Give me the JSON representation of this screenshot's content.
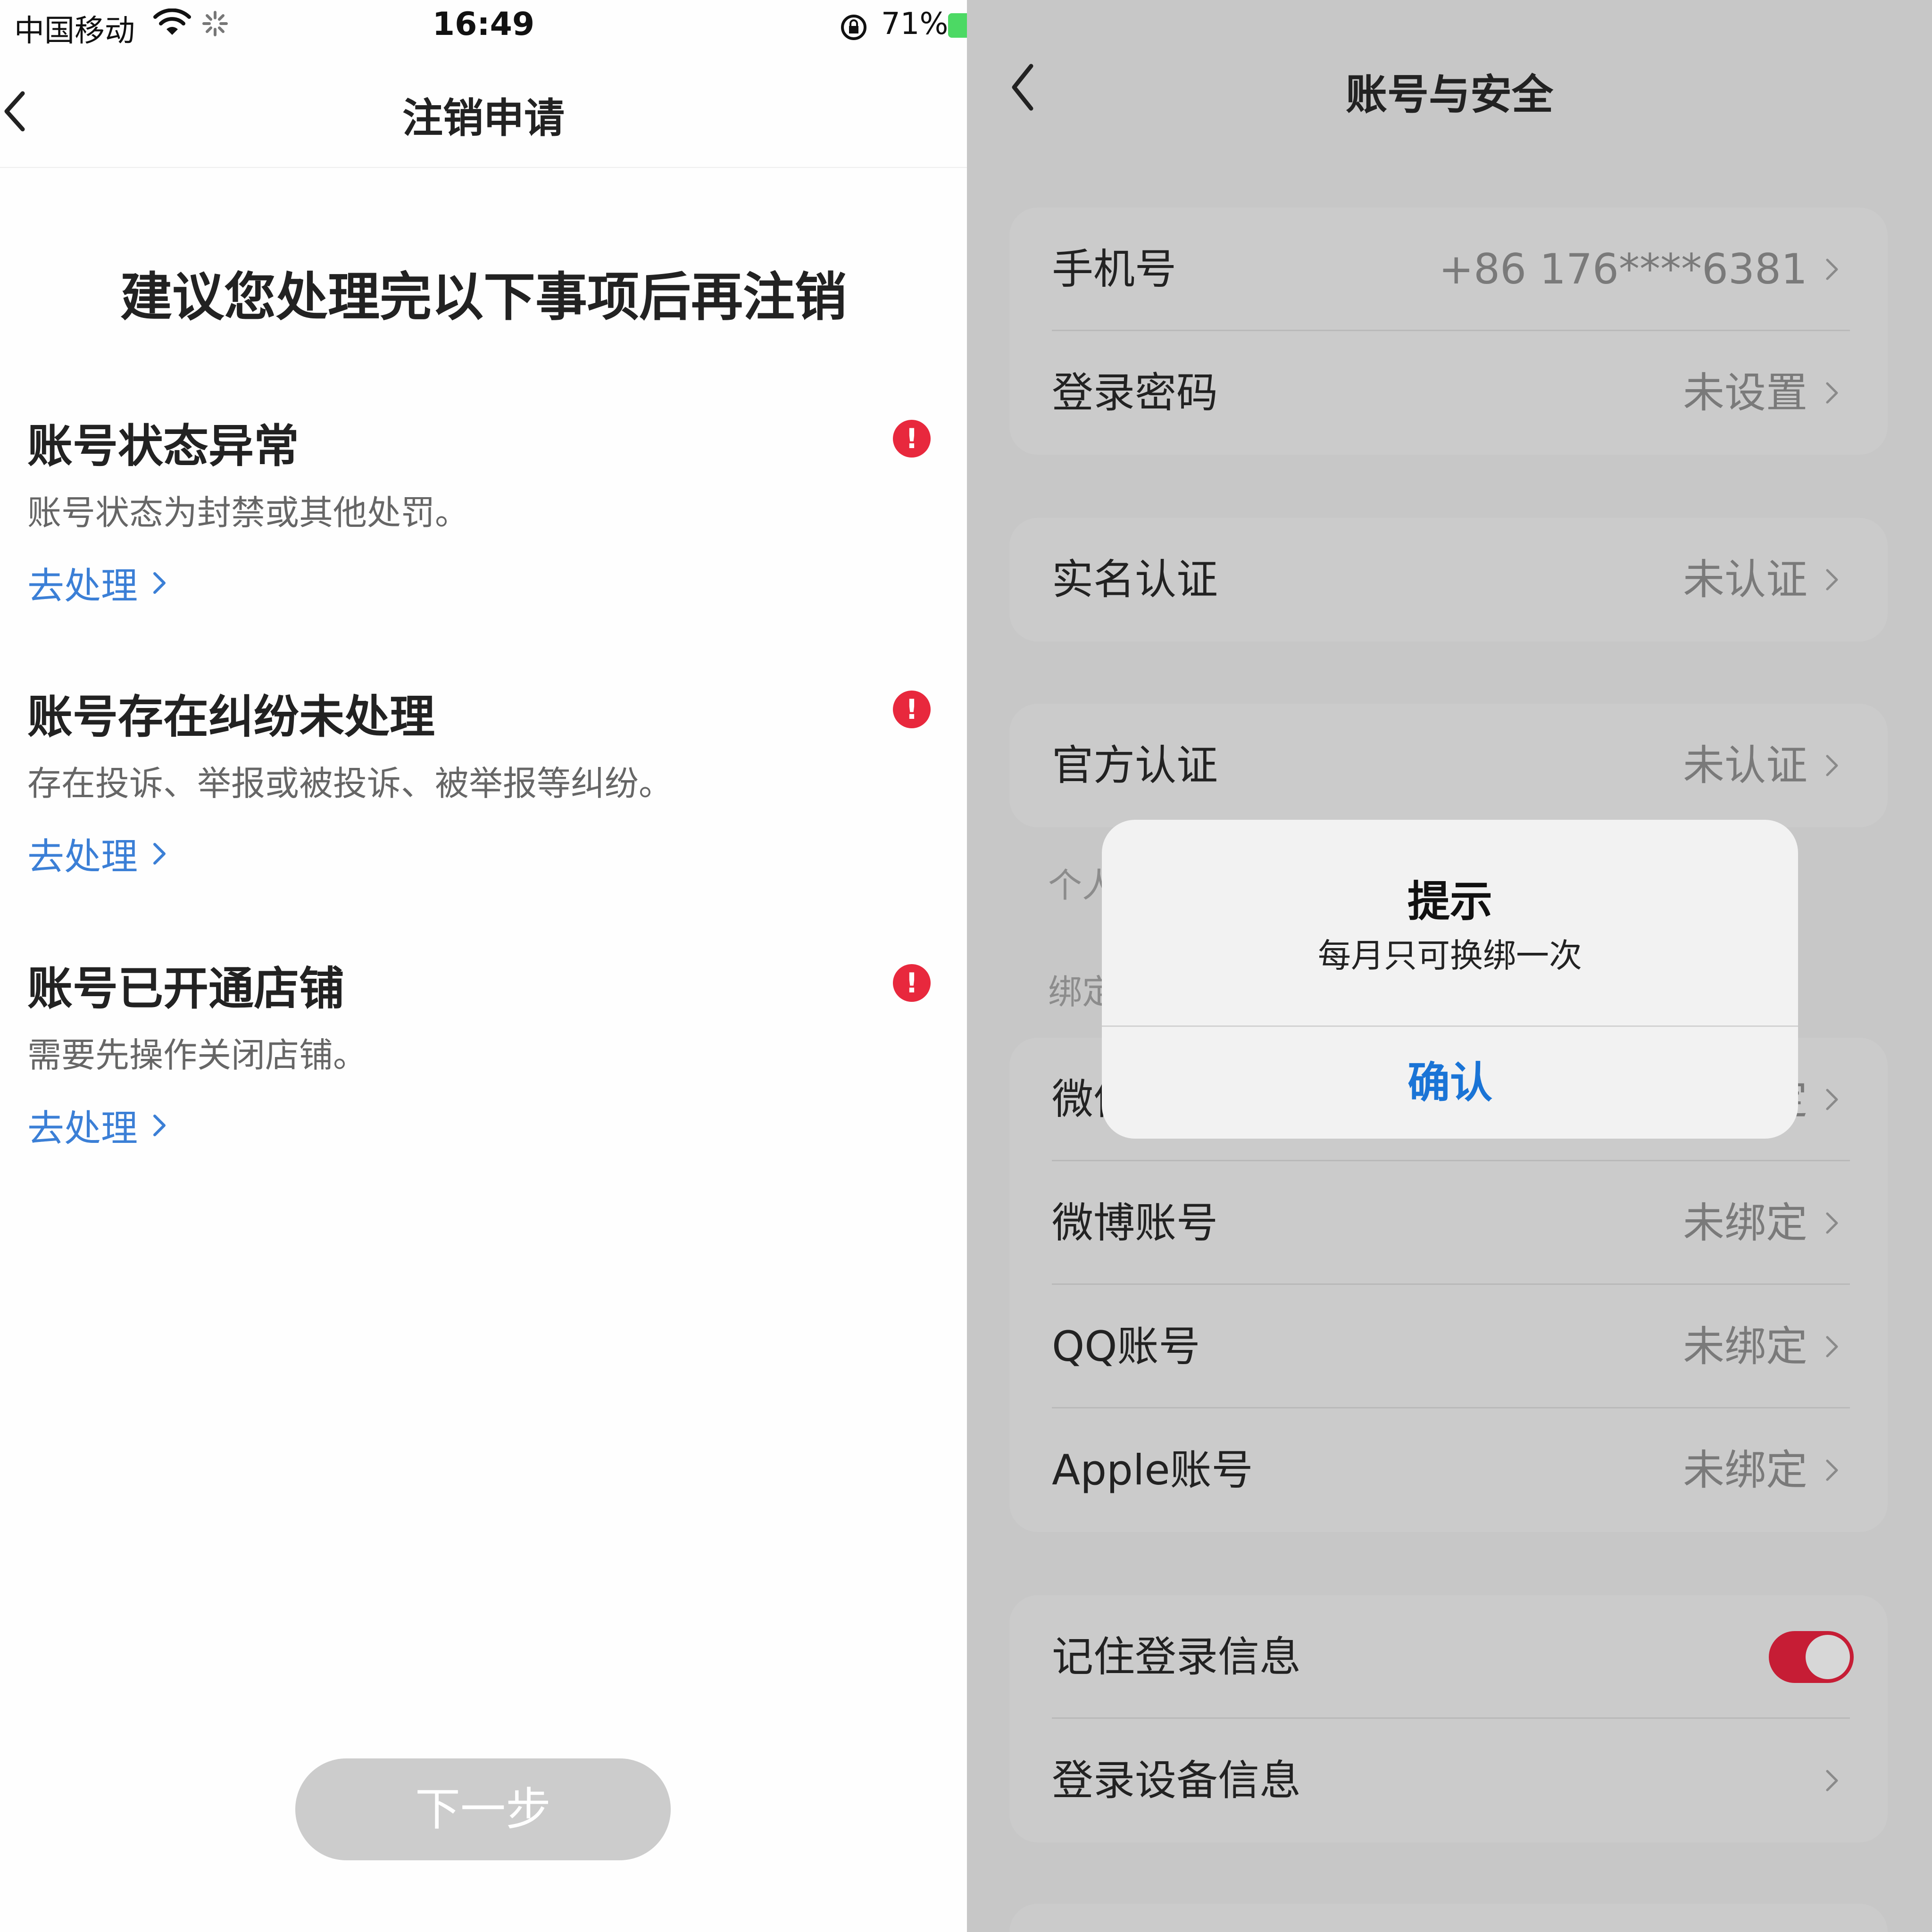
{
  "left": {
    "status_bar": {
      "carrier": "中国移动",
      "time": "16:49",
      "battery": "71%"
    },
    "nav": {
      "title": "注销申请"
    },
    "headline": "建议您处理完以下事项后再注销",
    "issues": [
      {
        "title": "账号状态异常",
        "desc": "账号状态为封禁或其他处罚。",
        "link": "去处理"
      },
      {
        "title": "账号存在纠纷未处理",
        "desc": "存在投诉、举报或被投诉、被举报等纠纷。",
        "link": "去处理"
      },
      {
        "title": "账号已开通店铺",
        "desc": "需要先操作关闭店铺。",
        "link": "去处理"
      }
    ],
    "alert_glyph": "!",
    "next_button": "下一步",
    "colors": {
      "link": "#3b7fd6",
      "alert": "#e8283d",
      "button_disabled": "#cccccc"
    }
  },
  "right": {
    "nav": {
      "title": "账号与安全"
    },
    "card1": [
      {
        "label": "手机号",
        "value": "+86 176****6381"
      },
      {
        "label": "登录密码",
        "value": "未设置"
      }
    ],
    "card2": [
      {
        "label": "实名认证",
        "value": "未认证"
      }
    ],
    "card3": [
      {
        "label": "官方认证",
        "value": "未认证"
      }
    ],
    "section_personal_partial": "个人",
    "section_bind_partial": "绑定",
    "card4": [
      {
        "label": "微信",
        "value": "未绑定"
      },
      {
        "label": "微博账号",
        "value": "未绑定"
      },
      {
        "label": "QQ账号",
        "value": "未绑定"
      },
      {
        "label": "Apple账号",
        "value": "未绑定"
      }
    ],
    "card5": [
      {
        "label": "记住登录信息",
        "toggle_on": true
      },
      {
        "label": "登录设备信息",
        "value": ""
      }
    ],
    "dialog": {
      "title": "提示",
      "message": "每月只可换绑一次",
      "confirm": "确认"
    },
    "colors": {
      "toggle_on": "#c61d35",
      "dialog_button": "#1a74d6"
    }
  }
}
